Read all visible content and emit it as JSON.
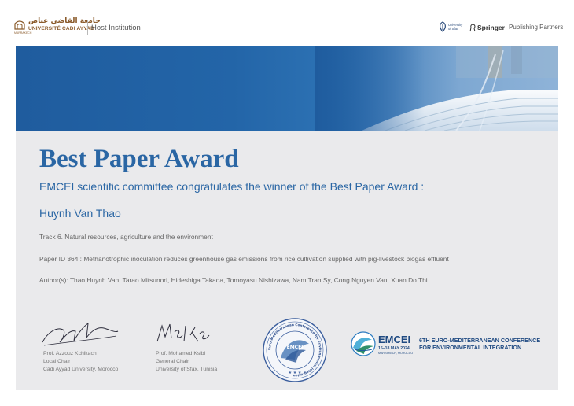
{
  "header": {
    "host_logo_arabic": "جامعة القاضي عياض",
    "host_logo_name": "UNIVERSITÉ CADI AYYAD",
    "host_logo_sub": "MARRAKECH",
    "host_label": "Host Institution",
    "sfax_logo_line1": "University",
    "sfax_logo_line2": "of Sfax",
    "springer_label": "Springer",
    "partners_label": "Publishing Partners"
  },
  "certificate": {
    "title": "Best Paper Award",
    "subtitle": "EMCEI scientific committee congratulates the winner of the Best Paper Award :",
    "winner": "Huynh Van Thao",
    "track": "Track 6. Natural resources, agriculture and the environment",
    "paper": "Paper ID 364 :  Methanotrophic inoculation reduces greenhouse gas emissions from rice cultivation supplied with pig-livestock biogas effluent",
    "authors": "Author(s): Thao Huynh Van, Tarao Mitsunori, Hideshiga Takada, Tomoyasu Nishizawa, Nam Tran Sy, Cong Nguyen Van, Xuan Do Thi"
  },
  "signatories": [
    {
      "name": "Prof. Azzouz Kchikach",
      "role": "Local Chair",
      "affiliation": "Cadi Ayyad University, Morocco"
    },
    {
      "name": "Prof. Mohamed Ksibi",
      "role": "General Chair",
      "affiliation": "University of Sfax, Tunisia"
    }
  ],
  "seal": {
    "ring_text": "Euro-Mediterranean Conference for Environmental Integration",
    "center_text": "EMCEI"
  },
  "conference": {
    "acronym": "EMCEI",
    "dates": "15–18 MAY 2024",
    "city": "MARRAKECH, MOROCCO",
    "line1": "6TH EURO-MEDITERRANEAN CONFERENCE",
    "line2": "FOR ENVIRONMENTAL INTEGRATION"
  },
  "colors": {
    "brand_blue": "#2a66a4",
    "panel_gray": "#eaeaec",
    "banner_blue": "#1f5c9e"
  }
}
